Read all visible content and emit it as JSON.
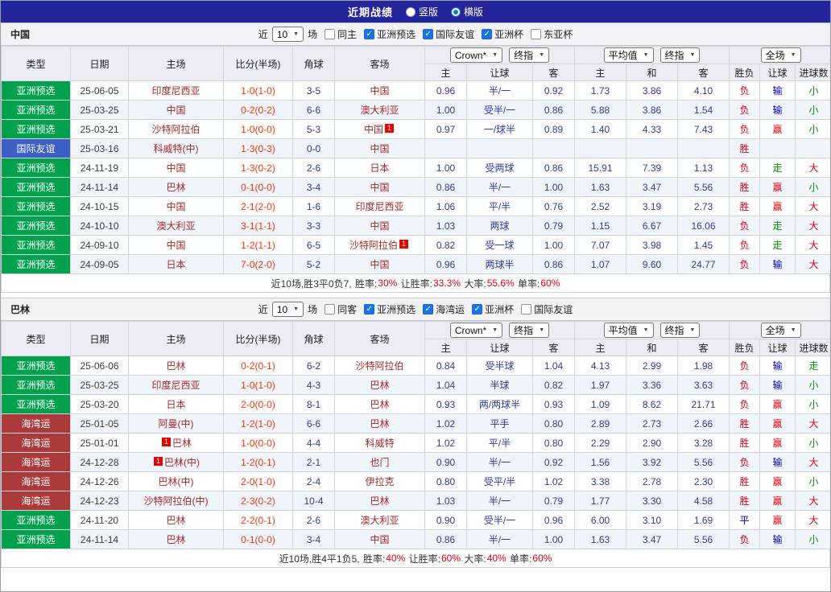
{
  "topbar": {
    "title": "近期战绩",
    "options": [
      {
        "label": "竖版",
        "selected": false
      },
      {
        "label": "横版",
        "selected": true
      }
    ]
  },
  "icons": {
    "dropdown_arrow": "▼",
    "check": "✓"
  },
  "colors": {
    "topbar_bg": "#24249c",
    "type_green": "#00a04c",
    "type_blue": "#3b5fc4",
    "type_darkred": "#ab3b3b",
    "team_text": "#a52a2a",
    "score_text": "#ff3300",
    "odds_text": "#333a9e",
    "result_red": "#e60012",
    "result_blue": "#0000cc",
    "result_green": "#009200"
  },
  "table": {
    "cols": [
      "类型",
      "日期",
      "主场",
      "比分(半场)",
      "角球",
      "客场"
    ],
    "sub": [
      "主",
      "让球",
      "客",
      "主",
      "和",
      "客",
      "胜负",
      "让球",
      "进球数"
    ],
    "selects": {
      "bookmaker": "Crown*",
      "stage1": "终指",
      "average": "平均值",
      "stage2": "终指",
      "scope": "全场"
    }
  },
  "sections": [
    {
      "team": "中国",
      "filters": {
        "recent_label": "近",
        "recent_value": "10",
        "games_label": "场",
        "checkboxes": [
          {
            "label": "同主",
            "checked": false
          },
          {
            "label": "亚洲预选",
            "checked": true
          },
          {
            "label": "国际友谊",
            "checked": true
          },
          {
            "label": "亚洲杯",
            "checked": true
          },
          {
            "label": "东亚杯",
            "checked": false
          }
        ]
      },
      "rows": [
        {
          "type": "亚洲预选",
          "type_color": "green",
          "date": "25-06-05",
          "home": "印度尼西亚",
          "score": "1-0(1-0)",
          "corners": "3-5",
          "away": "中国",
          "odds": [
            "0.96",
            "半/一",
            "0.92"
          ],
          "avg": [
            "1.73",
            "3.86",
            "4.10"
          ],
          "results": [
            "负|red",
            "输|blue",
            "小|green"
          ]
        },
        {
          "type": "亚洲预选",
          "type_color": "green",
          "date": "25-03-25",
          "home": "中国",
          "score": "0-2(0-2)",
          "corners": "6-6",
          "away": "澳大利亚",
          "odds": [
            "1.00",
            "受半/一",
            "0.86"
          ],
          "avg": [
            "5.88",
            "3.86",
            "1.54"
          ],
          "results": [
            "负|red",
            "输|blue",
            "小|green"
          ]
        },
        {
          "type": "亚洲预选",
          "type_color": "green",
          "date": "25-03-21",
          "home": "沙特阿拉伯",
          "score": "1-0(0-0)",
          "corners": "5-3",
          "away": "中国",
          "away_badge": {
            "text": "1",
            "pos": "after"
          },
          "odds": [
            "0.97",
            "一/球半",
            "0.89"
          ],
          "avg": [
            "1.40",
            "4.33",
            "7.43"
          ],
          "results": [
            "负|red",
            "赢|red",
            "小|green"
          ]
        },
        {
          "type": "国际友谊",
          "type_color": "blue",
          "date": "25-03-16",
          "home": "科威特(中)",
          "score": "1-3(0-3)",
          "corners": "0-0",
          "away": "中国",
          "odds": [
            "",
            "",
            ""
          ],
          "avg": [
            "",
            "",
            ""
          ],
          "results": [
            "胜|red",
            "",
            ""
          ]
        },
        {
          "type": "亚洲预选",
          "type_color": "green",
          "date": "24-11-19",
          "home": "中国",
          "score": "1-3(0-2)",
          "corners": "2-6",
          "away": "日本",
          "odds": [
            "1.00",
            "受两球",
            "0.86"
          ],
          "avg": [
            "15.91",
            "7.39",
            "1.13"
          ],
          "results": [
            "负|red",
            "走|green",
            "大|red"
          ]
        },
        {
          "type": "亚洲预选",
          "type_color": "green",
          "date": "24-11-14",
          "home": "巴林",
          "score": "0-1(0-0)",
          "corners": "3-4",
          "away": "中国",
          "odds": [
            "0.86",
            "半/一",
            "1.00"
          ],
          "avg": [
            "1.63",
            "3.47",
            "5.56"
          ],
          "results": [
            "胜|red",
            "赢|red",
            "小|green"
          ]
        },
        {
          "type": "亚洲预选",
          "type_color": "green",
          "date": "24-10-15",
          "home": "中国",
          "score": "2-1(2-0)",
          "corners": "1-6",
          "away": "印度尼西亚",
          "odds": [
            "1.06",
            "平/半",
            "0.76"
          ],
          "avg": [
            "2.52",
            "3.19",
            "2.73"
          ],
          "results": [
            "胜|red",
            "赢|red",
            "大|red"
          ]
        },
        {
          "type": "亚洲预选",
          "type_color": "green",
          "date": "24-10-10",
          "home": "澳大利亚",
          "score": "3-1(1-1)",
          "corners": "3-3",
          "away": "中国",
          "odds": [
            "1.03",
            "两球",
            "0.79"
          ],
          "avg": [
            "1.15",
            "6.67",
            "16.06"
          ],
          "results": [
            "负|red",
            "走|green",
            "大|red"
          ]
        },
        {
          "type": "亚洲预选",
          "type_color": "green",
          "date": "24-09-10",
          "home": "中国",
          "score": "1-2(1-1)",
          "corners": "6-5",
          "away": "沙特阿拉伯",
          "away_badge": {
            "text": "1",
            "pos": "after"
          },
          "odds": [
            "0.82",
            "受一球",
            "1.00"
          ],
          "avg": [
            "7.07",
            "3.98",
            "1.45"
          ],
          "results": [
            "负|red",
            "走|green",
            "大|red"
          ]
        },
        {
          "type": "亚洲预选",
          "type_color": "green",
          "date": "24-09-05",
          "home": "日本",
          "score": "7-0(2-0)",
          "corners": "5-2",
          "away": "中国",
          "odds": [
            "0.96",
            "两球半",
            "0.86"
          ],
          "avg": [
            "1.07",
            "9.60",
            "24.77"
          ],
          "results": [
            "负|red",
            "输|blue",
            "大|red"
          ]
        }
      ],
      "summary": {
        "prefix": "近10场,胜3平0负7,",
        "stats": [
          {
            "label": "胜率:",
            "value": "30%"
          },
          {
            "label": "让胜率:",
            "value": "33.3%"
          },
          {
            "label": "大率:",
            "value": "55.6%"
          },
          {
            "label": "单率:",
            "value": "60%"
          }
        ]
      }
    },
    {
      "team": "巴林",
      "filters": {
        "recent_label": "近",
        "recent_value": "10",
        "games_label": "场",
        "checkboxes": [
          {
            "label": "同客",
            "checked": false
          },
          {
            "label": "亚洲预选",
            "checked": true
          },
          {
            "label": "海湾运",
            "checked": true
          },
          {
            "label": "亚洲杯",
            "checked": true
          },
          {
            "label": "国际友谊",
            "checked": false
          }
        ]
      },
      "rows": [
        {
          "type": "亚洲预选",
          "type_color": "green",
          "date": "25-06-06",
          "home": "巴林",
          "score": "0-2(0-1)",
          "corners": "6-2",
          "away": "沙特阿拉伯",
          "odds": [
            "0.84",
            "受半球",
            "1.04"
          ],
          "avg": [
            "4.13",
            "2.99",
            "1.98"
          ],
          "results": [
            "负|red",
            "输|blue",
            "走|green"
          ]
        },
        {
          "type": "亚洲预选",
          "type_color": "green",
          "date": "25-03-25",
          "home": "印度尼西亚",
          "score": "1-0(1-0)",
          "corners": "4-3",
          "away": "巴林",
          "odds": [
            "1.04",
            "半球",
            "0.82"
          ],
          "avg": [
            "1.97",
            "3.36",
            "3.63"
          ],
          "results": [
            "负|red",
            "输|blue",
            "小|green"
          ]
        },
        {
          "type": "亚洲预选",
          "type_color": "green",
          "date": "25-03-20",
          "home": "日本",
          "score": "2-0(0-0)",
          "corners": "8-1",
          "away": "巴林",
          "odds": [
            "0.93",
            "两/两球半",
            "0.93"
          ],
          "avg": [
            "1.09",
            "8.62",
            "21.71"
          ],
          "results": [
            "负|red",
            "赢|red",
            "小|green"
          ]
        },
        {
          "type": "海湾运",
          "type_color": "darkred",
          "date": "25-01-05",
          "home": "阿曼(中)",
          "score": "1-2(1-0)",
          "corners": "6-6",
          "away": "巴林",
          "odds": [
            "1.02",
            "平手",
            "0.80"
          ],
          "avg": [
            "2.89",
            "2.73",
            "2.66"
          ],
          "results": [
            "胜|red",
            "赢|red",
            "大|red"
          ]
        },
        {
          "type": "海湾运",
          "type_color": "darkred",
          "date": "25-01-01",
          "home": "巴林",
          "home_badge": {
            "text": "1",
            "pos": "before"
          },
          "score": "1-0(0-0)",
          "corners": "4-4",
          "away": "科威特",
          "odds": [
            "1.02",
            "平/半",
            "0.80"
          ],
          "avg": [
            "2.29",
            "2.90",
            "3.28"
          ],
          "results": [
            "胜|red",
            "赢|red",
            "小|green"
          ]
        },
        {
          "type": "海湾运",
          "type_color": "darkred",
          "date": "24-12-28",
          "home": "巴林(中)",
          "home_badge": {
            "text": "1",
            "pos": "before"
          },
          "score": "1-2(0-1)",
          "corners": "2-1",
          "away": "也门",
          "odds": [
            "0.90",
            "半/一",
            "0.92"
          ],
          "avg": [
            "1.56",
            "3.92",
            "5.56"
          ],
          "results": [
            "负|red",
            "输|blue",
            "大|red"
          ]
        },
        {
          "type": "海湾运",
          "type_color": "darkred",
          "date": "24-12-26",
          "home": "巴林(中)",
          "score": "2-0(1-0)",
          "corners": "2-4",
          "away": "伊拉克",
          "odds": [
            "0.80",
            "受平/半",
            "1.02"
          ],
          "avg": [
            "3.38",
            "2.78",
            "2.30"
          ],
          "results": [
            "胜|red",
            "赢|red",
            "小|green"
          ]
        },
        {
          "type": "海湾运",
          "type_color": "darkred",
          "date": "24-12-23",
          "home": "沙特阿拉伯(中)",
          "score": "2-3(0-2)",
          "corners": "10-4",
          "away": "巴林",
          "odds": [
            "1.03",
            "半/一",
            "0.79"
          ],
          "avg": [
            "1.77",
            "3.30",
            "4.58"
          ],
          "results": [
            "胜|red",
            "赢|red",
            "大|red"
          ]
        },
        {
          "type": "亚洲预选",
          "type_color": "green",
          "date": "24-11-20",
          "home": "巴林",
          "score": "2-2(0-1)",
          "corners": "2-6",
          "away": "澳大利亚",
          "odds": [
            "0.90",
            "受半/一",
            "0.96"
          ],
          "avg": [
            "6.00",
            "3.10",
            "1.69"
          ],
          "results": [
            "平|blue",
            "赢|red",
            "大|red"
          ]
        },
        {
          "type": "亚洲预选",
          "type_color": "green",
          "date": "24-11-14",
          "home": "巴林",
          "score": "0-1(0-0)",
          "corners": "3-4",
          "away": "中国",
          "odds": [
            "0.86",
            "半/一",
            "1.00"
          ],
          "avg": [
            "1.63",
            "3.47",
            "5.56"
          ],
          "results": [
            "负|red",
            "输|blue",
            "小|green"
          ]
        }
      ],
      "summary": {
        "prefix": "近10场,胜4平1负5,",
        "stats": [
          {
            "label": "胜率:",
            "value": "40%"
          },
          {
            "label": "让胜率:",
            "value": "60%"
          },
          {
            "label": "大率:",
            "value": "40%"
          },
          {
            "label": "单率:",
            "value": "60%"
          }
        ]
      }
    }
  ]
}
